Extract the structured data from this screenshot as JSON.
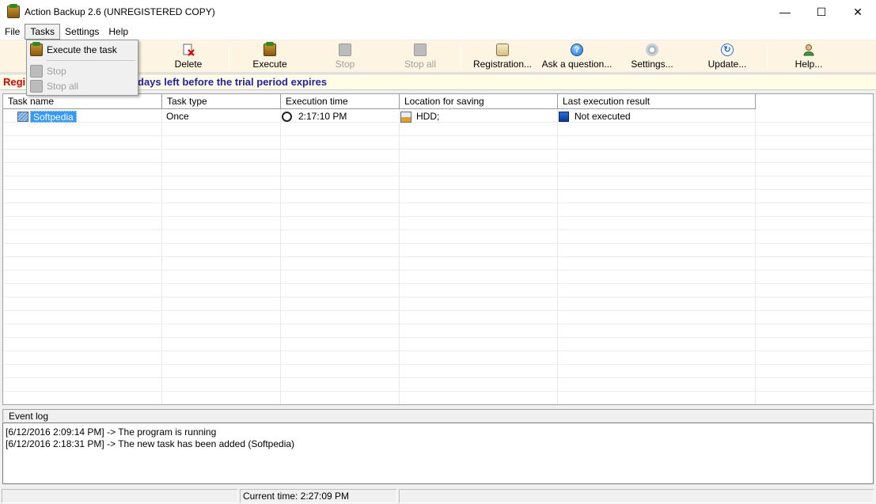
{
  "window": {
    "title": "Action Backup 2.6 (UNREGISTERED COPY)",
    "controls": [
      "—",
      "☐",
      "✕"
    ]
  },
  "menu": {
    "file": "File",
    "tasks": "Tasks",
    "settings": "Settings",
    "help": "Help"
  },
  "tasks_menu": {
    "items": [
      {
        "label": "Execute the task",
        "enabled": true
      },
      {
        "label": "Stop",
        "enabled": false
      },
      {
        "label": "Stop all",
        "enabled": false
      }
    ]
  },
  "toolbar": {
    "delete": "Delete",
    "execute": "Execute",
    "stop": "Stop",
    "stop_all": "Stop all",
    "registration": "Registration...",
    "ask": "Ask a question...",
    "settings": "Settings...",
    "update": "Update...",
    "help": "Help..."
  },
  "banner": {
    "left": "Regi",
    "right": "days left before the trial period expires",
    "colors": {
      "left": "#e00000",
      "right": "#1f1fb0"
    }
  },
  "grid": {
    "columns": [
      "Task name",
      "Task type",
      "Execution time",
      "Location for saving",
      "Last execution result"
    ],
    "rows": [
      {
        "name": "Softpedia",
        "type": "Once",
        "time": "2:17:10 PM",
        "location": "HDD;",
        "result": "Not executed"
      }
    ]
  },
  "event_log": {
    "title": "Event log",
    "lines": [
      "[6/12/2016 2:09:14 PM] -> The program is running",
      "[6/12/2016 2:18:31 PM] -> The new task has been added  (Softpedia)"
    ]
  },
  "status": {
    "current_time": "Current time: 2:27:09 PM"
  }
}
